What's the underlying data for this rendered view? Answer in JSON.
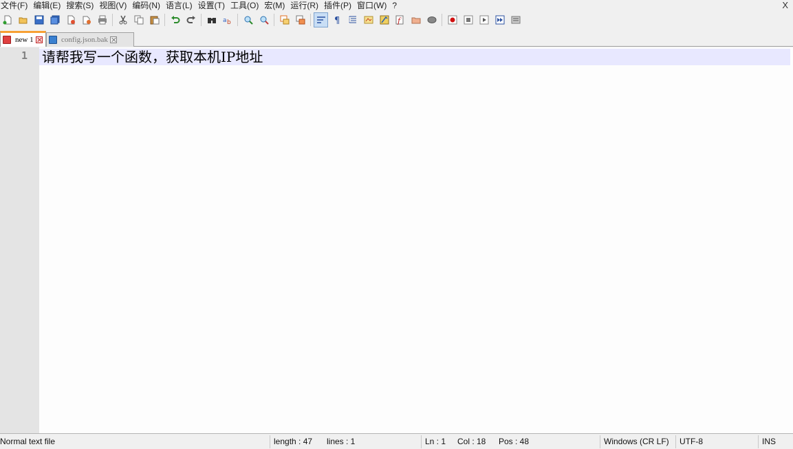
{
  "menu": {
    "items": [
      "文件(F)",
      "编辑(E)",
      "搜索(S)",
      "视图(V)",
      "编码(N)",
      "语言(L)",
      "设置(T)",
      "工具(O)",
      "宏(M)",
      "运行(R)",
      "插件(P)",
      "窗口(W)",
      "?"
    ],
    "close_label": "X"
  },
  "toolbar": {
    "icons": [
      "new-file-icon",
      "open-file-icon",
      "save-icon",
      "save-all-icon",
      "close-icon",
      "close-all-icon",
      "print-icon",
      "cut-icon",
      "copy-icon",
      "paste-icon",
      "undo-icon",
      "redo-icon",
      "find-icon",
      "replace-icon",
      "zoom-in-icon",
      "zoom-out-icon",
      "sync-vertical-icon",
      "sync-horizontal-icon",
      "word-wrap-icon",
      "show-all-chars-icon",
      "indent-guide-icon",
      "user-language-icon",
      "document-map-icon",
      "function-list-icon",
      "folder-workspace-icon",
      "monitoring-icon",
      "record-macro-icon",
      "stop-macro-icon",
      "play-macro-icon",
      "run-macro-multiple-icon",
      "save-macro-icon"
    ]
  },
  "tabs": [
    {
      "label": "new 1",
      "active": true
    },
    {
      "label": "config.json.bak",
      "active": false
    }
  ],
  "editor": {
    "line_number": "1",
    "line_text": "请帮我写一个函数，获取本机IP地址"
  },
  "status": {
    "file_type": "Normal text file",
    "length": "length : 47",
    "lines": "lines : 1",
    "ln": "Ln : 1",
    "col": "Col : 18",
    "pos": "Pos : 48",
    "eol": "Windows (CR LF)",
    "encoding": "UTF-8",
    "mode": "INS"
  },
  "colors": {
    "accent_tab": "#f7a033",
    "current_line": "#e8e8ff",
    "gutter": "#e4e4e4"
  }
}
